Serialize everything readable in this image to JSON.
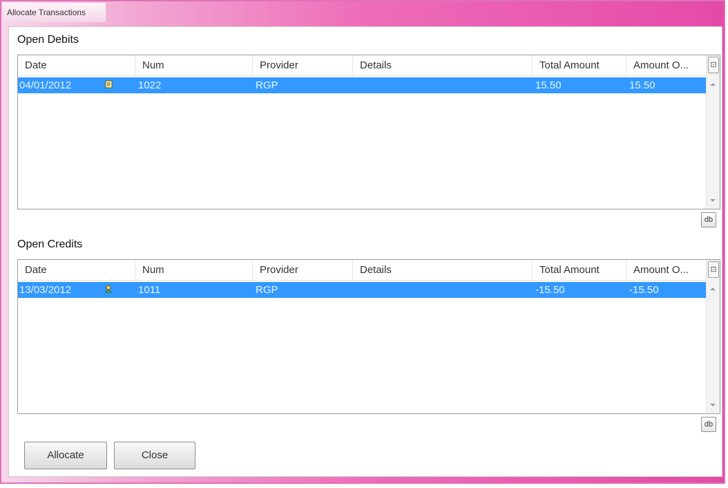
{
  "window": {
    "title": "Allocate Transactions"
  },
  "debits": {
    "section_title": "Open Debits",
    "columns": [
      "Date",
      "Num",
      "Provider",
      "Details",
      "Total Amount",
      "Amount O..."
    ],
    "rows": [
      {
        "date": "04/01/2012",
        "num": "1022",
        "provider": "RGP",
        "details": "",
        "total_amount": "15.50",
        "amount_outstanding": "15.50",
        "icon": "document-icon"
      }
    ],
    "corner_button_icon": "grid-menu-icon",
    "side_button_icon": "db-icon"
  },
  "credits": {
    "section_title": "Open Credits",
    "columns": [
      "Date",
      "Num",
      "Provider",
      "Details",
      "Total Amount",
      "Amount O..."
    ],
    "rows": [
      {
        "date": "13/03/2012",
        "num": "1011",
        "provider": "RGP",
        "details": "",
        "total_amount": "-15.50",
        "amount_outstanding": "-15.50",
        "icon": "user-icon"
      }
    ],
    "corner_button_icon": "grid-menu-icon",
    "side_button_icon": "db-icon"
  },
  "buttons": {
    "allocate_label": "Allocate",
    "close_label": "Close"
  },
  "colors": {
    "selection": "#3399ff",
    "window_frame": "#e44aa8"
  }
}
